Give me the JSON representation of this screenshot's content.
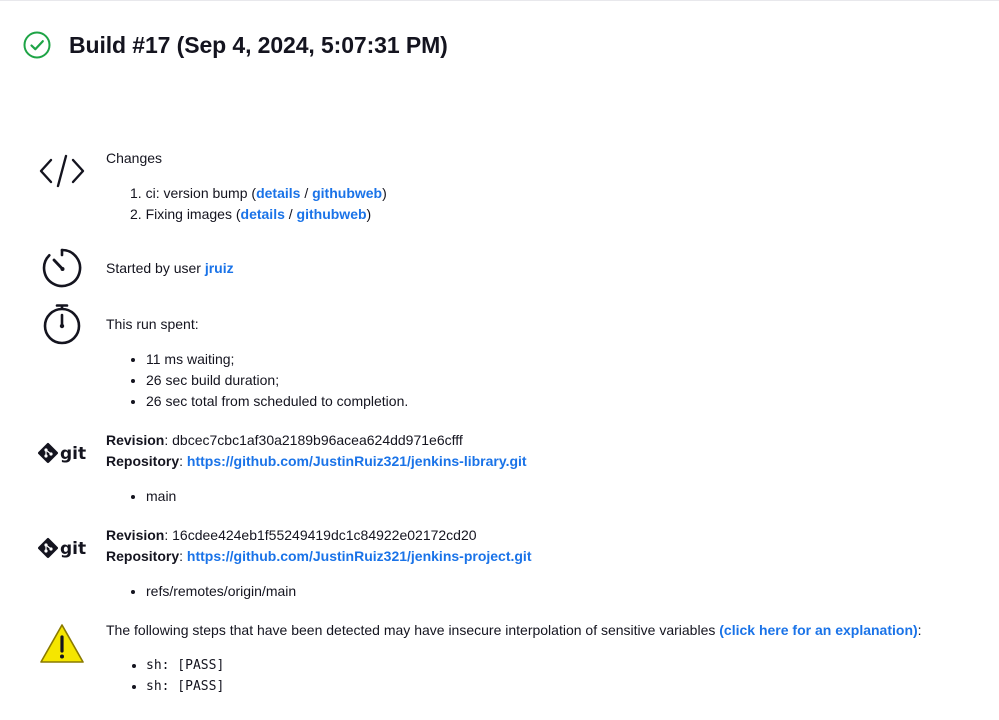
{
  "build": {
    "title": "Build #17 (Sep 4, 2024, 5:07:31 PM)",
    "status": "success"
  },
  "changes": {
    "heading": "Changes",
    "items": [
      {
        "num": "1.",
        "text": "ci: version bump",
        "details": "details",
        "sep": "/",
        "web": "githubweb"
      },
      {
        "num": "2.",
        "text": "Fixing images",
        "details": "details",
        "sep": "/",
        "web": "githubweb"
      }
    ]
  },
  "started": {
    "prefix": "Started by user",
    "user": "jruiz"
  },
  "timing": {
    "heading": "This run spent:",
    "items": [
      "11 ms waiting;",
      "26 sec build duration;",
      "26 sec total from scheduled to completion."
    ]
  },
  "git": [
    {
      "revision_label": "Revision",
      "revision": "dbcec7cbc1af30a2189b96acea624dd971e6cfff",
      "repo_label": "Repository",
      "repo": "https://github.com/JustinRuiz321/jenkins-library.git",
      "branches": [
        "main"
      ],
      "logo_text": "git"
    },
    {
      "revision_label": "Revision",
      "revision": "16cdee424eb1f55249419dc1c84922e02172cd20",
      "repo_label": "Repository",
      "repo": "https://github.com/JustinRuiz321/jenkins-project.git",
      "branches": [
        "refs/remotes/origin/main"
      ],
      "logo_text": "git"
    }
  ],
  "warning": {
    "text": "The following steps that have been detected may have insecure interpolation of sensitive variables",
    "link": "(click here for an explanation)",
    "suffix": ":",
    "steps": [
      "sh: [PASS]",
      "sh: [PASS]"
    ]
  },
  "colors": {
    "success": "#1ea446",
    "link": "#1a73e8",
    "warning_fill": "#f5e600",
    "warning_stroke": "#8a7a00"
  }
}
